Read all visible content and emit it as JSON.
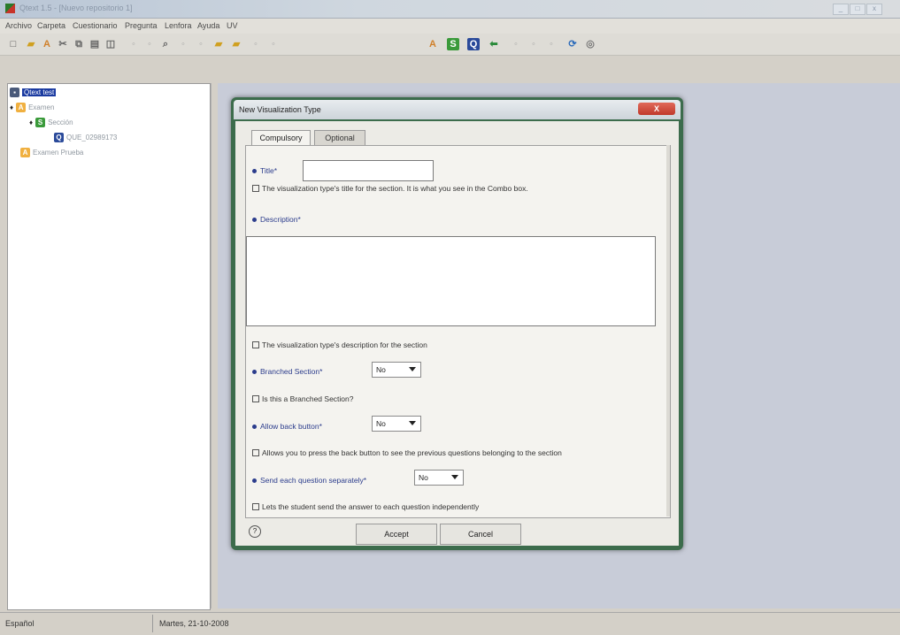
{
  "window": {
    "title": "Qtext 1.5 - [Nuevo repositorio 1]"
  },
  "menu": [
    "Archivo",
    "Carpeta",
    "Cuestionario",
    "Pregunta",
    "Lenfora",
    "Ayuda",
    "UV"
  ],
  "toolbar": {
    "icons": [
      "new-icon",
      "open-folder-icon",
      "a-icon",
      "cut-icon",
      "copy-icon",
      "paste-icon",
      "duplicate-icon",
      "zoom-icon",
      "folder-icon",
      "folder-icon",
      "a-icon",
      "s-icon",
      "q-icon",
      "back-arrow-icon",
      "refresh-icon",
      "about-icon"
    ],
    "labels": {
      "a": "A",
      "s": "S",
      "q": "Q"
    }
  },
  "tree": {
    "root": "Qtext test",
    "items": [
      {
        "label": "Examen",
        "icon": "A"
      },
      {
        "label": "Sección",
        "icon": "S"
      },
      {
        "label": "QUE_02989173",
        "icon": "Q"
      },
      {
        "label": "Examen Prueba",
        "icon": "A"
      }
    ]
  },
  "status": {
    "language": "Español",
    "date": "Martes, 21-10-2008"
  },
  "dialog": {
    "title": "New Visualization Type",
    "close_label": "X",
    "tabs": {
      "compulsory": "Compulsory",
      "optional": "Optional"
    },
    "title_field": {
      "label": "Title*",
      "value": "",
      "help": "The visualization type's title for the section. It is what you see in the Combo box."
    },
    "description_field": {
      "label": "Description*",
      "value": "",
      "help": "The visualization type's description for the section"
    },
    "branched_section": {
      "label": "Branched Section*",
      "value": "No",
      "help": "Is this a Branched Section?"
    },
    "allow_back": {
      "label": "Allow back button*",
      "value": "No",
      "help": "Allows you to press the back button to see the previous questions belonging to the section"
    },
    "send_each": {
      "label": "Send each question separately*",
      "value": "No",
      "help": "Lets the student send the answer to each question independently"
    },
    "accept_label": "Accept",
    "cancel_label": "Cancel",
    "help_icon": "?"
  }
}
